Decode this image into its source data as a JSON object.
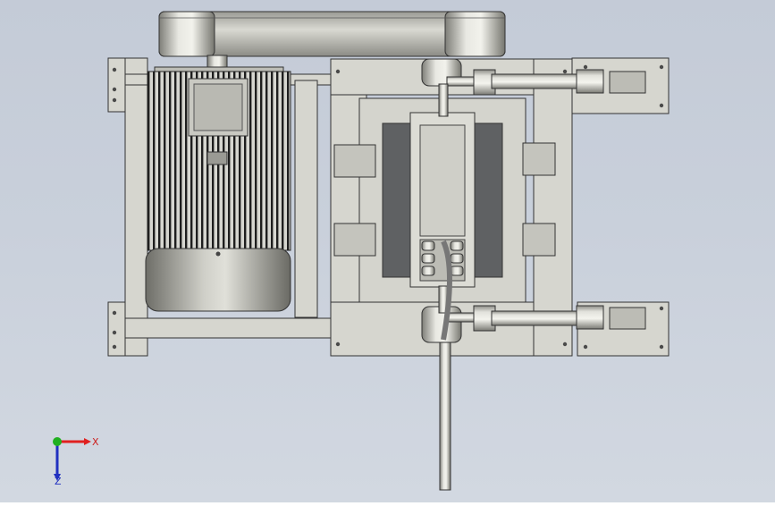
{
  "viewport": {
    "background_top": "#c4cbd7",
    "background_bottom": "#d2d8e1"
  },
  "model": {
    "components": [
      "motor",
      "belt-guard",
      "frame",
      "cylinder-top",
      "cylinder-bottom",
      "center-housing",
      "vertical-rod"
    ]
  },
  "triad": {
    "x_label": "X",
    "z_label": "Z",
    "x_color": "#e02020",
    "y_color": "#20b020",
    "z_color": "#2030c0"
  }
}
